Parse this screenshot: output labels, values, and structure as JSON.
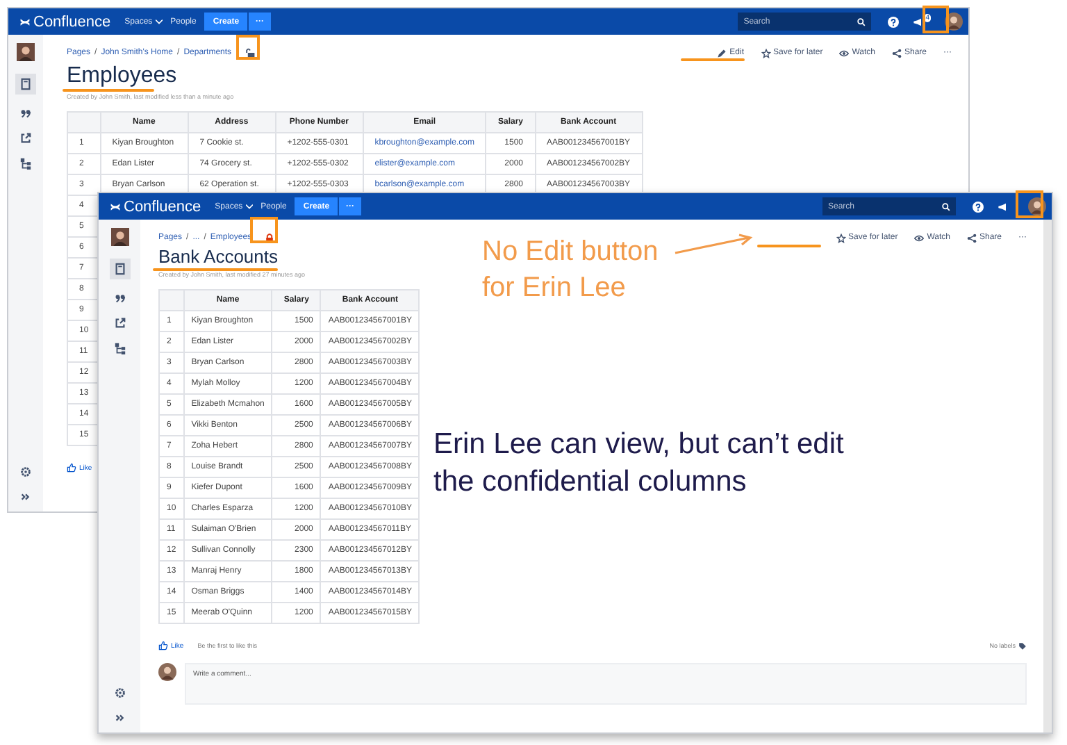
{
  "windows": [
    {
      "kind": "back",
      "nav": {
        "logo": "Confluence",
        "items": [
          "Spaces",
          "People"
        ],
        "create": "Create",
        "more": "···"
      },
      "search": {
        "placeholder": "Search"
      },
      "notifications": "4",
      "breadcrumbs": [
        "Pages",
        "John Smith's Home",
        "Departments"
      ],
      "separator": "/",
      "locked": false,
      "actions": [
        {
          "label": "Edit",
          "kind": "edit"
        },
        {
          "label": "Save for later",
          "kind": "save"
        },
        {
          "label": "Watch",
          "kind": "watch"
        },
        {
          "label": "Share",
          "kind": "share"
        },
        {
          "label": "···",
          "kind": "more"
        }
      ],
      "title": "Employees",
      "meta": "Created by John Smith, last modified less than a minute ago",
      "columns": [
        {
          "kind": "num"
        },
        {
          "label": "Name",
          "kind": "text"
        },
        {
          "label": "Address",
          "kind": "text"
        },
        {
          "label": "Phone Number",
          "kind": "text"
        },
        {
          "label": "Email",
          "kind": "link"
        },
        {
          "label": "Salary",
          "kind": "num"
        },
        {
          "label": "Bank Account",
          "kind": "text"
        }
      ],
      "rows": [
        [
          "1",
          "Kiyan Broughton",
          "7 Cookie st.",
          "+1202-555-0301",
          "kbroughton@example.com",
          "1500",
          "AAB001234567001BY"
        ],
        [
          "2",
          "Edan Lister",
          "74 Grocery st.",
          "+1202-555-0302",
          "elister@example.com",
          "2000",
          "AAB001234567002BY"
        ],
        [
          "3",
          "Bryan Carlson",
          "62 Operation st.",
          "+1202-555-0303",
          "bcarlson@example.com",
          "2800",
          "AAB001234567003BY"
        ],
        [
          "4"
        ],
        [
          "5"
        ],
        [
          "6"
        ],
        [
          "7"
        ],
        [
          "8"
        ],
        [
          "9"
        ],
        [
          "10"
        ],
        [
          "11"
        ],
        [
          "12"
        ],
        [
          "13"
        ],
        [
          "14"
        ],
        [
          "15"
        ]
      ],
      "footer": {
        "like": "Like"
      }
    },
    {
      "kind": "front",
      "nav": {
        "logo": "Confluence",
        "items": [
          "Spaces",
          "People"
        ],
        "create": "Create",
        "more": "···"
      },
      "search": {
        "placeholder": "Search"
      },
      "breadcrumbs": [
        "Pages",
        "...",
        "Employees"
      ],
      "separator": "/",
      "locked": true,
      "actions": [
        {
          "label": "Save for later",
          "kind": "save"
        },
        {
          "label": "Watch",
          "kind": "watch"
        },
        {
          "label": "Share",
          "kind": "share"
        },
        {
          "label": "···",
          "kind": "more"
        }
      ],
      "title": "Bank Accounts",
      "meta": "Created by John Smith, last modified 27 minutes ago",
      "columns": [
        {
          "kind": "num"
        },
        {
          "label": "Name",
          "kind": "text"
        },
        {
          "label": "Salary",
          "kind": "num"
        },
        {
          "label": "Bank Account",
          "kind": "text"
        }
      ],
      "rows": [
        [
          "1",
          "Kiyan Broughton",
          "1500",
          "AAB001234567001BY"
        ],
        [
          "2",
          "Edan Lister",
          "2000",
          "AAB001234567002BY"
        ],
        [
          "3",
          "Bryan Carlson",
          "2800",
          "AAB001234567003BY"
        ],
        [
          "4",
          "Mylah Molloy",
          "1200",
          "AAB001234567004BY"
        ],
        [
          "5",
          "Elizabeth Mcmahon",
          "1600",
          "AAB001234567005BY"
        ],
        [
          "6",
          "Vikki Benton",
          "2500",
          "AAB001234567006BY"
        ],
        [
          "7",
          "Zoha Hebert",
          "2800",
          "AAB001234567007BY"
        ],
        [
          "8",
          "Louise Brandt",
          "2500",
          "AAB001234567008BY"
        ],
        [
          "9",
          "Kiefer Dupont",
          "1600",
          "AAB001234567009BY"
        ],
        [
          "10",
          "Charles Esparza",
          "1200",
          "AAB001234567010BY"
        ],
        [
          "11",
          "Sulaiman O'Brien",
          "2000",
          "AAB001234567011BY"
        ],
        [
          "12",
          "Sullivan Connolly",
          "2300",
          "AAB001234567012BY"
        ],
        [
          "13",
          "Manraj Henry",
          "1800",
          "AAB001234567013BY"
        ],
        [
          "14",
          "Osman Briggs",
          "1400",
          "AAB001234567014BY"
        ],
        [
          "15",
          "Meerab O'Quinn",
          "1200",
          "AAB001234567015BY"
        ]
      ],
      "footer": {
        "like": "Like",
        "like_hint": "Be the first to like this",
        "labels": "No labels",
        "comment_placeholder": "Write a comment..."
      }
    }
  ],
  "annotations": {
    "callout": [
      "No Edit button",
      "for Erin Lee"
    ],
    "note": [
      "Erin Lee can view, but can’t edit",
      "the confidential columns"
    ]
  }
}
